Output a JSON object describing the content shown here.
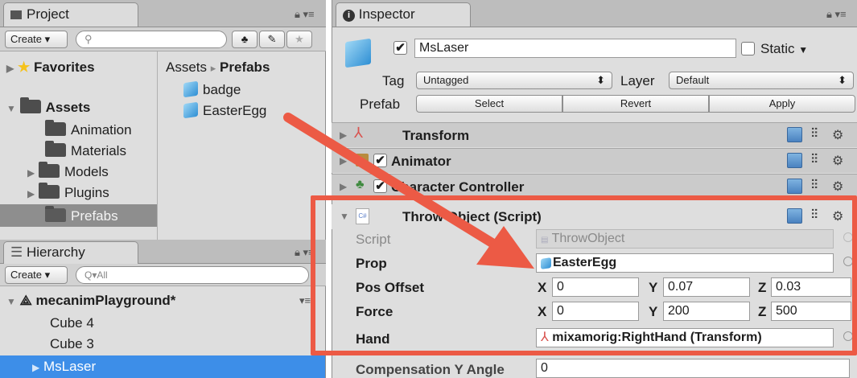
{
  "project": {
    "tab": "Project",
    "create": "Create ▾",
    "search_placeholder": "",
    "favorites": "Favorites",
    "assets": "Assets",
    "folders": [
      "Animation",
      "Materials",
      "Models",
      "Plugins",
      "Prefabs"
    ],
    "breadcrumb_root": "Assets",
    "breadcrumb_sep": "▸",
    "breadcrumb_current": "Prefabs",
    "files": [
      "badge",
      "EasterEgg"
    ]
  },
  "hierarchy": {
    "tab": "Hierarchy",
    "create": "Create ▾",
    "search_placeholder": "Q▾All",
    "scene": "mecanimPlayground*",
    "items": [
      "Cube 4",
      "Cube 3",
      "MsLaser"
    ]
  },
  "inspector": {
    "tab": "Inspector",
    "name": "MsLaser",
    "static": "Static",
    "tag_label": "Tag",
    "tag_value": "Untagged",
    "layer_label": "Layer",
    "layer_value": "Default",
    "prefab_label": "Prefab",
    "prefab_buttons": [
      "Select",
      "Revert",
      "Apply"
    ],
    "components": [
      "Transform",
      "Animator",
      "Character Controller",
      "Throw Object (Script)"
    ],
    "script_label": "Script",
    "script_value": "ThrowObject",
    "prop_label": "Prop",
    "prop_value": "EasterEgg",
    "pos_label": "Pos Offset",
    "pos": {
      "x": "0",
      "y": "0.07",
      "z": "0.03"
    },
    "force_label": "Force",
    "force": {
      "x": "0",
      "y": "200",
      "z": "500"
    },
    "hand_label": "Hand",
    "hand_value": "mixamorig:RightHand (Transform)",
    "comp_label": "Compensation Y Angle",
    "comp_value": "0"
  },
  "axis": {
    "x": "X",
    "y": "Y",
    "z": "Z"
  },
  "colors": {
    "selection": "#3d8ee8",
    "highlight_box": "#ec5a45",
    "arrow": "#ec5a45"
  }
}
